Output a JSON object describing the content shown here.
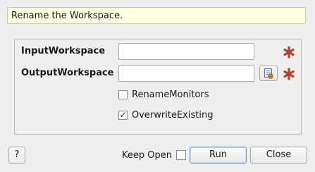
{
  "description": "Rename the Workspace.",
  "properties": {
    "input_workspace": {
      "label": "InputWorkspace",
      "value": "",
      "required": true
    },
    "output_workspace": {
      "label": "OutputWorkspace",
      "value": "",
      "required": true
    },
    "rename_monitors": {
      "label": "RenameMonitors",
      "checked": false
    },
    "overwrite_existing": {
      "label": "OverwriteExisting",
      "checked": true
    }
  },
  "footer": {
    "help_label": "?",
    "keep_open_label": "Keep Open",
    "keep_open_checked": false,
    "run_label": "Run",
    "close_label": "Close"
  },
  "icons": {
    "required": "asterisk-icon",
    "browse": "workspace-picker-icon",
    "check": "check-mark-icon"
  },
  "colors": {
    "description_background": "#ffffe1",
    "required_star": "#b5402f",
    "default_button_border": "#6d96c6"
  }
}
